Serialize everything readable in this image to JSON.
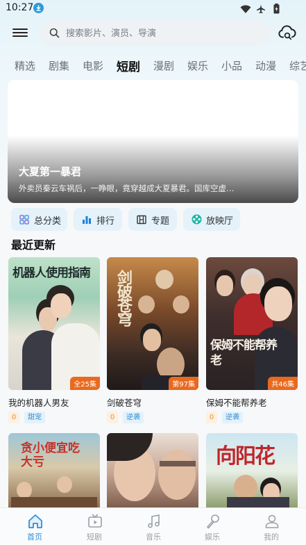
{
  "status_bar": {
    "time": "10:27"
  },
  "search": {
    "placeholder": "搜索影片、演员、导演"
  },
  "tabs": [
    "精选",
    "剧集",
    "电影",
    "短剧",
    "漫剧",
    "娱乐",
    "小品",
    "动漫",
    "综艺"
  ],
  "active_tab": "短剧",
  "banner": {
    "title": "大夏第一暴君",
    "description": "外卖员秦云车祸后，一睁眼，竟穿越成大夏暴君。国库空虚…"
  },
  "quick_nav": [
    {
      "label": "总分类",
      "icon": "grid-icon"
    },
    {
      "label": "排行",
      "icon": "bar-chart-icon"
    },
    {
      "label": "专题",
      "icon": "topic-icon"
    },
    {
      "label": "放映厅",
      "icon": "film-reel-icon"
    }
  ],
  "section": {
    "title": "最近更新"
  },
  "cards": [
    {
      "title": "我的机器人男友",
      "badge": "全25集",
      "count": "0",
      "genre": "甜宠",
      "poster_text": "机器人使用指南"
    },
    {
      "title": "剑破苍穹",
      "badge": "第97集",
      "count": "0",
      "genre": "逆袭",
      "poster_text": "剑破苍穹"
    },
    {
      "title": "保姆不能帮养老",
      "badge": "共46集",
      "count": "0",
      "genre": "逆袭",
      "poster_text": "保姆不能帮养老"
    }
  ],
  "row2_posters": [
    {
      "poster_text": "贪小便宜吃大亏"
    },
    {
      "poster_text": ""
    },
    {
      "poster_text": "向阳花"
    }
  ],
  "bottom_nav": [
    {
      "label": "首页",
      "icon": "home-icon",
      "active": true
    },
    {
      "label": "短剧",
      "icon": "short-drama-icon",
      "active": false
    },
    {
      "label": "音乐",
      "icon": "music-icon",
      "active": false
    },
    {
      "label": "娱乐",
      "icon": "microphone-icon",
      "active": false
    },
    {
      "label": "我的",
      "icon": "profile-icon",
      "active": false
    }
  ],
  "colors": {
    "accent": "#2c8fde",
    "badge": "#e86a1f",
    "tag_genre": "#2e8fd3"
  }
}
